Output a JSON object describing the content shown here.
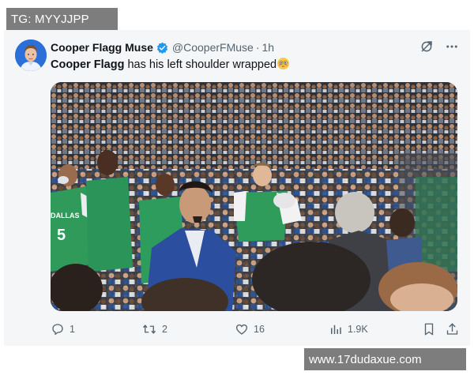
{
  "overlay": {
    "tg_label": "TG: MYYJJPP",
    "watermark": "www.17dudaxue.com"
  },
  "tweet": {
    "author_name": "Cooper Flagg Muse",
    "author_handle": "@CooperFMuse",
    "separator": "·",
    "time": "1h",
    "text_name": "Cooper Flagg",
    "text_rest": " has his left shoulder wrapped",
    "verified_color": "#1d9bf0"
  },
  "photo": {
    "jersey_numbers": [
      "5"
    ],
    "jersey_text": "DALLAS"
  },
  "stats": {
    "replies": "1",
    "reposts": "2",
    "likes": "16",
    "views": "1.9K"
  },
  "icons": {
    "grok": "grok-icon",
    "more": "more-icon",
    "reply": "reply-icon",
    "repost": "repost-icon",
    "like": "heart-icon",
    "views": "views-icon",
    "bookmark": "bookmark-icon",
    "share": "share-icon"
  }
}
